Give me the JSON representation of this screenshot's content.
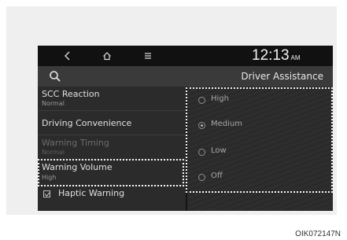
{
  "status_bar": {
    "back_icon": "back-icon",
    "home_icon": "home-icon",
    "menu_icon": "menu-icon",
    "time": "12:13",
    "ampm": "AM"
  },
  "header": {
    "search_icon": "search-icon",
    "title": "Driver Assistance"
  },
  "menu": {
    "items": [
      {
        "label": "SCC Reaction",
        "value": "Normal",
        "enabled": true
      },
      {
        "label": "Driving Convenience",
        "value": "",
        "enabled": true
      },
      {
        "label": "Warning Timing",
        "value": "Normal",
        "enabled": false
      },
      {
        "label": "Warning Volume",
        "value": "High",
        "enabled": true,
        "highlighted": true
      },
      {
        "label": "Haptic Warning",
        "value": "",
        "enabled": true,
        "checkbox": true,
        "checked": true
      }
    ]
  },
  "options": {
    "items": [
      {
        "label": "High",
        "selected": false
      },
      {
        "label": "Medium",
        "selected": true
      },
      {
        "label": "Low",
        "selected": false
      },
      {
        "label": "Off",
        "selected": false
      }
    ]
  },
  "image_code": "OIK072147N"
}
